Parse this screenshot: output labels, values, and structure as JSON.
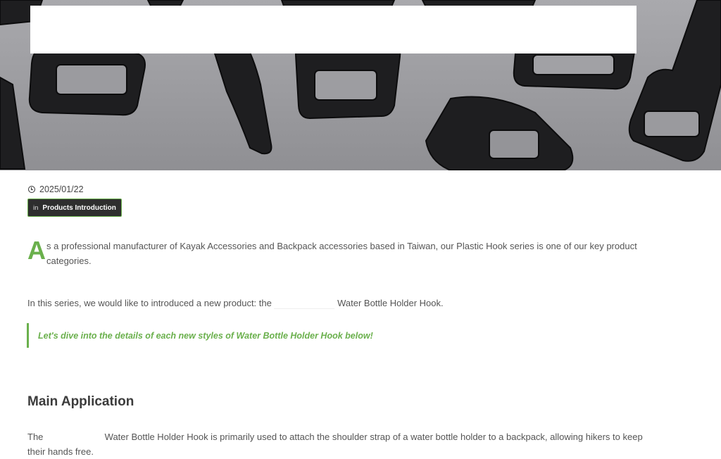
{
  "hero": {
    "image_alt": "black plastic buckles and hooks"
  },
  "meta": {
    "date": "2025/01/22",
    "category_prefix": "in",
    "category": "Products Introduction"
  },
  "article": {
    "dropcap": "A",
    "intro": "s a professional manufacturer of Kayak Accessories and Backpack accessories based in Taiwan, our Plastic Hook series is one of our key product categories.",
    "para2_before": "In this series, we would like to introduced a new product: the",
    "para2_after": "Water Bottle Holder Hook.",
    "quote": "Let's dive into the details of each new styles of  Water Bottle Holder Hook below!",
    "section_title": "Main Application",
    "para3_before": "The",
    "para3_after": "Water Bottle Holder Hook is primarily used to attach the shoulder strap of a water bottle holder to a backpack, allowing hikers to keep their hands free."
  },
  "colors": {
    "accent": "#6ab04c",
    "badge_bg": "#2e2e2e"
  }
}
